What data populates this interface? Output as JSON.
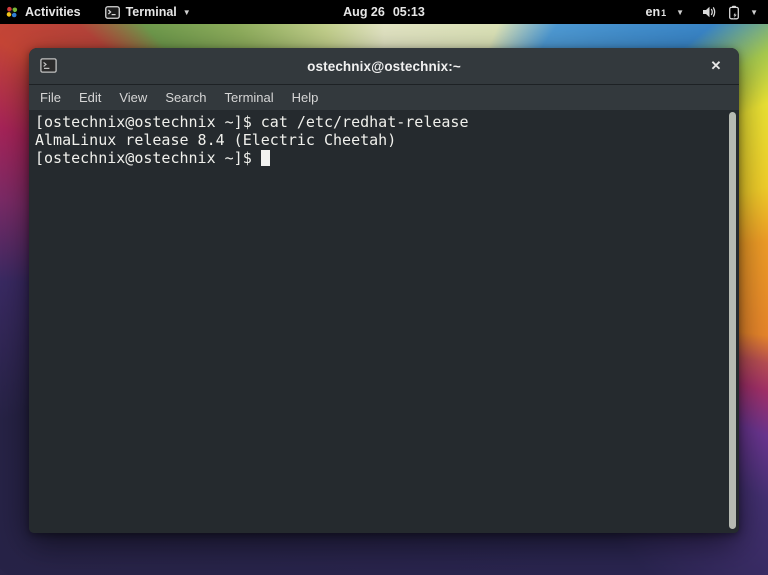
{
  "top_bar": {
    "activities_label": "Activities",
    "app_menu": {
      "label": "Terminal",
      "caret": "▼"
    },
    "clock": {
      "date": "Aug 26",
      "time": "05:13"
    },
    "system_tray": {
      "keyboard_layout": {
        "label": "en",
        "sub": "1",
        "caret": "▼"
      },
      "menu_caret": "▼"
    }
  },
  "window": {
    "title": "ostechnix@ostechnix:~",
    "close_glyph": "✕",
    "menu_bar": [
      "File",
      "Edit",
      "View",
      "Search",
      "Terminal",
      "Help"
    ]
  },
  "terminal": {
    "lines": [
      "[ostechnix@ostechnix ~]$ cat /etc/redhat-release",
      "AlmaLinux release 8.4 (Electric Cheetah)",
      "[ostechnix@ostechnix ~]$ "
    ],
    "cursor_style": "block"
  },
  "colors": {
    "top_bar_bg": "#000000",
    "window_chrome_bg": "#33393d",
    "terminal_bg": "#252a2e",
    "terminal_fg": "#f0f0ec",
    "scrollbar_thumb": "#b6bab2"
  }
}
